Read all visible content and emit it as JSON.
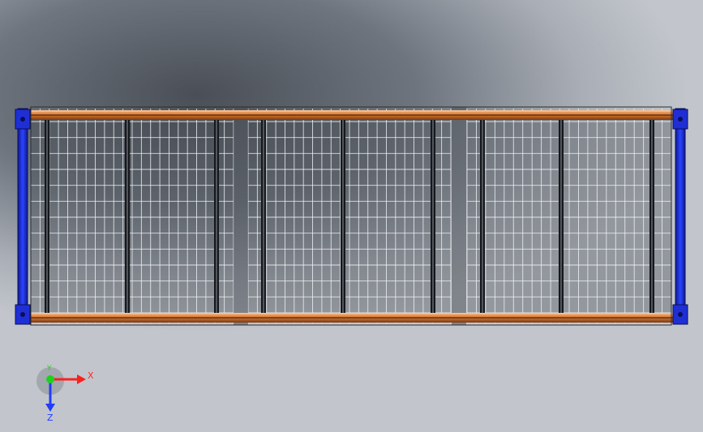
{
  "viewport": {
    "name": "cad-graphics-area",
    "model": {
      "panels": 3,
      "vertical_posts_per_panel": 3,
      "mesh_columns_per_panel": 22,
      "mesh_rows": 12
    },
    "colors": {
      "frame_blue": "#1f2fd6",
      "rail_orange": "#e07a2e",
      "rail_dark": "#3a2a20",
      "mesh": "#f2f4f7",
      "post": "#15181c"
    }
  },
  "triad": {
    "x_label": "X",
    "y_label": "Y",
    "z_label": "Z",
    "colors": {
      "x": "#ff1f1f",
      "y": "#1fd11f",
      "z": "#1f3cff"
    }
  }
}
